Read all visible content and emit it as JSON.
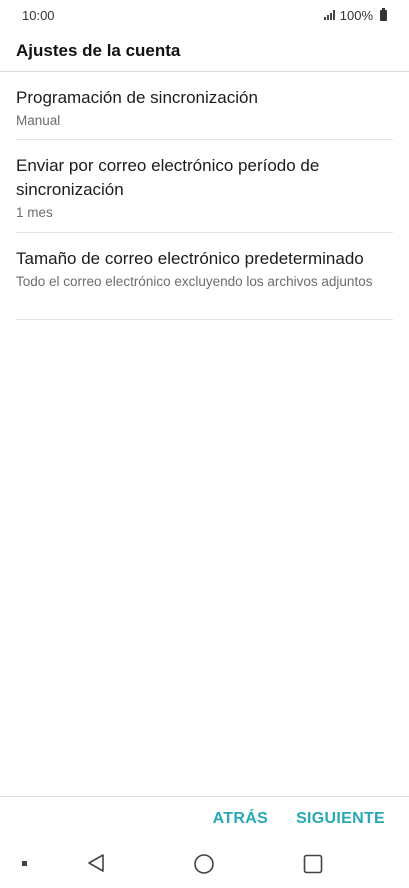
{
  "status_bar": {
    "time": "10:00",
    "battery": "100%"
  },
  "header": {
    "title": "Ajustes de la cuenta"
  },
  "settings": [
    {
      "title": "Programación de sincronización",
      "subtitle": "Manual"
    },
    {
      "title": "Enviar por correo electrónico período de sincronización",
      "subtitle": "1 mes"
    },
    {
      "title": "Tamaño de correo electrónico predeterminado",
      "subtitle": "Todo el correo electrónico excluyendo los archivos adjuntos"
    }
  ],
  "actions": {
    "back_label": "ATRÁS",
    "next_label": "SIGUIENTE"
  },
  "nav_bar": {
    "icons": [
      "dot-icon",
      "back-triangle-icon",
      "home-circle-icon",
      "recents-square-icon"
    ]
  },
  "colors": {
    "accent": "#27a8b4"
  }
}
